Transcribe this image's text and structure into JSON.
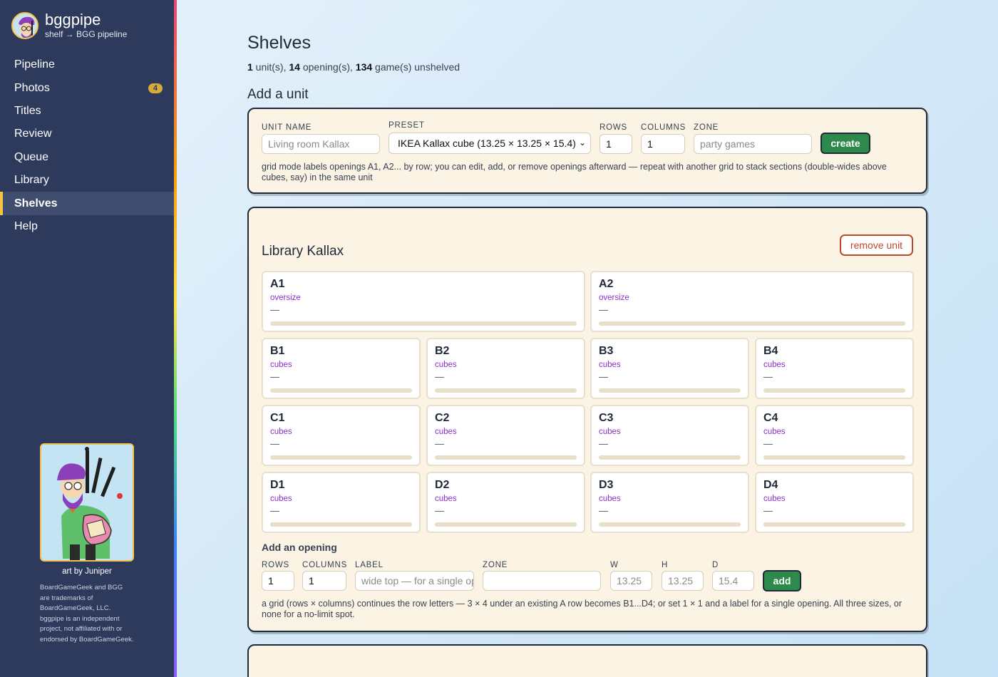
{
  "brand": {
    "name": "bggpipe",
    "subtitle": "shelf → BGG pipeline"
  },
  "nav": [
    {
      "label": "Pipeline",
      "badge": ""
    },
    {
      "label": "Photos",
      "badge": "4"
    },
    {
      "label": "Titles",
      "badge": ""
    },
    {
      "label": "Review",
      "badge": ""
    },
    {
      "label": "Queue",
      "badge": ""
    },
    {
      "label": "Library",
      "badge": ""
    },
    {
      "label": "Shelves",
      "badge": "",
      "active": true
    },
    {
      "label": "Help",
      "badge": ""
    }
  ],
  "art": {
    "credit": "art by Juniper",
    "legal": "BoardGameGeek and BGG are trademarks of BoardGameGeek, LLC. bggpipe is an independent project, not affiliated with or endorsed by BoardGameGeek."
  },
  "page": {
    "title": "Shelves",
    "summary": {
      "units": "1",
      "units_label": " unit(s), ",
      "openings": "14",
      "openings_label": " opening(s), ",
      "unshelved": "134",
      "unshelved_label": " game(s) unshelved"
    }
  },
  "add_unit": {
    "title": "Add a unit",
    "unit_name_label": "UNIT NAME",
    "unit_name_placeholder": "Living room Kallax",
    "preset_label": "PRESET",
    "preset_value": "IKEA Kallax cube (13.25 × 13.25 × 15.4)",
    "rows_label": "ROWS",
    "rows_value": "1",
    "columns_label": "COLUMNS",
    "columns_value": "1",
    "zone_label": "ZONE",
    "zone_placeholder": "party games",
    "create_label": "create",
    "hint": "grid mode labels openings A1, A2... by row; you can edit, add, or remove openings afterward — repeat with another grid to stack sections (double-wides above cubes, say) in the same unit"
  },
  "unit": {
    "name": "Library Kallax",
    "remove_label": "remove unit",
    "openings": [
      {
        "name": "A1",
        "zone": "oversize",
        "value": "—"
      },
      {
        "name": "A2",
        "zone": "oversize",
        "value": "—"
      },
      {
        "name": "B1",
        "zone": "cubes",
        "value": "—"
      },
      {
        "name": "B2",
        "zone": "cubes",
        "value": "—"
      },
      {
        "name": "B3",
        "zone": "cubes",
        "value": "—"
      },
      {
        "name": "B4",
        "zone": "cubes",
        "value": "—"
      },
      {
        "name": "C1",
        "zone": "cubes",
        "value": "—"
      },
      {
        "name": "C2",
        "zone": "cubes",
        "value": "—"
      },
      {
        "name": "C3",
        "zone": "cubes",
        "value": "—"
      },
      {
        "name": "C4",
        "zone": "cubes",
        "value": "—"
      },
      {
        "name": "D1",
        "zone": "cubes",
        "value": "—"
      },
      {
        "name": "D2",
        "zone": "cubes",
        "value": "—"
      },
      {
        "name": "D3",
        "zone": "cubes",
        "value": "—"
      },
      {
        "name": "D4",
        "zone": "cubes",
        "value": "—"
      }
    ],
    "add_opening": {
      "title": "Add an opening",
      "rows_label": "ROWS",
      "rows_value": "1",
      "columns_label": "COLUMNS",
      "columns_value": "1",
      "label_label": "LABEL",
      "label_placeholder": "wide top — for a single opening",
      "zone_label": "ZONE",
      "zone_value": "",
      "w_label": "W",
      "w_placeholder": "13.25",
      "h_label": "H",
      "h_placeholder": "13.25",
      "d_label": "D",
      "d_placeholder": "15.4",
      "add_label": "add",
      "hint": "a grid (rows × columns) continues the row letters — 3 × 4 under an existing A row becomes B1...D4; or set 1 × 1 and a label for a single opening. All three sizes, or none for a no-limit spot."
    }
  },
  "colors": {
    "sidebar": "#2d3a5c",
    "accent": "#f5c542",
    "panel": "#fbf3e4",
    "green": "#2d8a4c",
    "remove": "#c2462b",
    "zone": "#8b2fc9"
  }
}
